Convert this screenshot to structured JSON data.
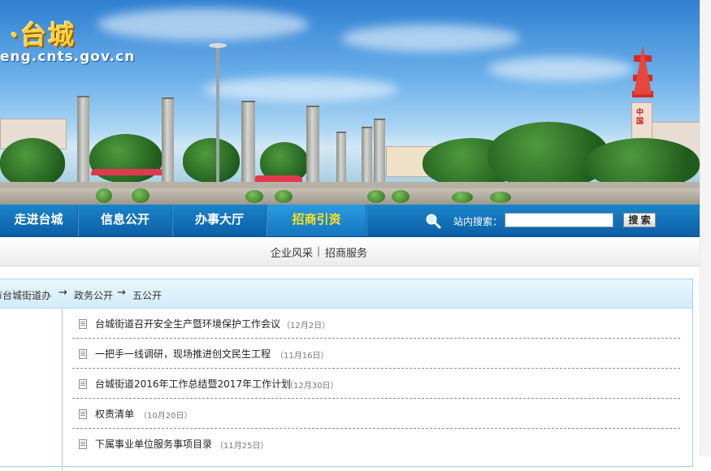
{
  "header": {
    "title": "·台城",
    "url": "eng.cnts.gov.cn",
    "tower_text": "中国"
  },
  "nav": {
    "items": [
      {
        "label": "走进台城"
      },
      {
        "label": "信息公开"
      },
      {
        "label": "办事大厅"
      },
      {
        "label": "招商引资"
      }
    ],
    "active_index": 3
  },
  "search": {
    "label": "站内搜索：",
    "value": "",
    "placeholder": "",
    "button_label": "搜 索",
    "icon": "magnifier-icon"
  },
  "subnav": {
    "links": [
      "企业风采",
      "招商服务"
    ],
    "separator": "|"
  },
  "breadcrumb": {
    "items": [
      "市台城街道办",
      "政务公开",
      "五公开"
    ],
    "arrow": "→"
  },
  "news": [
    {
      "title": "台城街道召开安全生产暨环境保护工作会议",
      "date": "（12月2日）"
    },
    {
      "title": "一把手一线调研，现场推进创文民生工程",
      "date": "（11月16日）"
    },
    {
      "title": "台城街道2016年工作总结暨2017年工作计划",
      "date": "（12月30日）"
    },
    {
      "title": "权责清单",
      "date": "（10月20日）"
    },
    {
      "title": "下属事业单位服务事项目录",
      "date": "（11月25日）"
    }
  ],
  "colors": {
    "nav_bg": "#0b5fa6",
    "nav_active_text": "#ffe11a",
    "brand_yellow": "#f6d23a",
    "panel_border": "#9cd3ee"
  }
}
